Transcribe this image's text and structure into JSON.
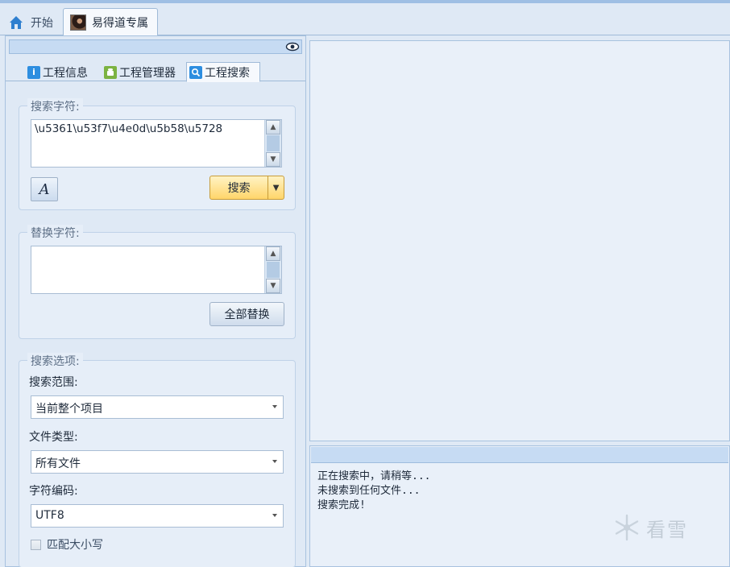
{
  "doc_tabs": [
    {
      "label": "开始",
      "icon": "home-icon"
    },
    {
      "label": "易得道专属",
      "icon": "avatar"
    }
  ],
  "left_panel": {
    "subtabs": [
      {
        "label": "工程信息",
        "icon": "info-icon"
      },
      {
        "label": "工程管理器",
        "icon": "android-icon"
      },
      {
        "label": "工程搜索",
        "icon": "search-icon"
      }
    ],
    "search_group": {
      "title": "搜索字符:",
      "value": "\\u5361\\u53f7\\u4e0d\\u5b58\\u5728",
      "font_button_label": "A",
      "search_button_label": "搜索"
    },
    "replace_group": {
      "title": "替换字符:",
      "value": "",
      "replace_all_label": "全部替换"
    },
    "options_group": {
      "title": "搜索选项:",
      "scope_label": "搜索范围:",
      "scope_value": "当前整个项目",
      "filetype_label": "文件类型:",
      "filetype_value": "所有文件",
      "encoding_label": "字符编码:",
      "encoding_value": "UTF8",
      "match_case_label": "匹配大小写",
      "match_case_checked": false
    }
  },
  "log": [
    "正在搜索中，请稍等...",
    "未搜索到任何文件...",
    "搜索完成!"
  ],
  "watermark": "看雪",
  "colors": {
    "accent": "#c6dbf3",
    "search_button": "#ffd56a",
    "panel": "#dfe9f5"
  }
}
